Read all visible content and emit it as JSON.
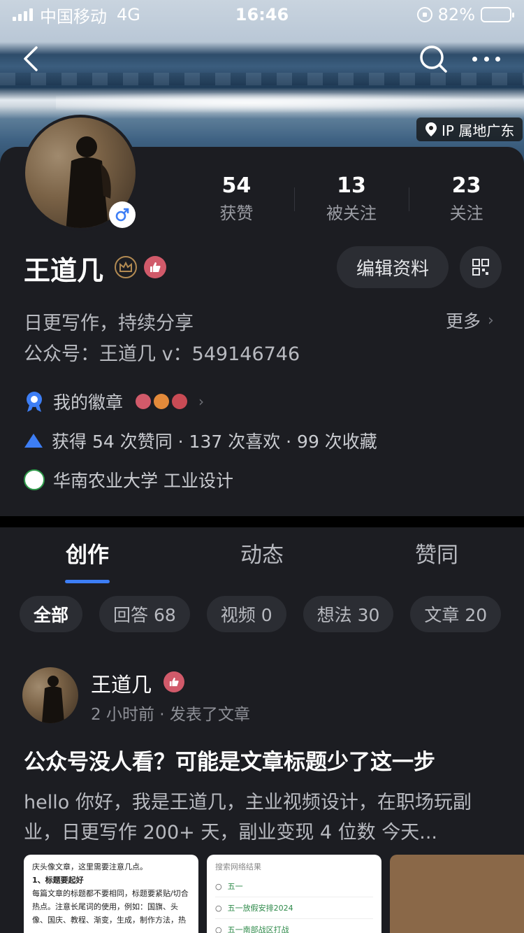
{
  "status_bar": {
    "carrier": "中国移动",
    "network": "4G",
    "time": "16:46",
    "battery": "82%",
    "battery_level": 0.82
  },
  "header": {
    "ip_location": "IP 属地广东",
    "icons": [
      "back-arrow-icon",
      "search-icon",
      "more-icon",
      "location-pin-icon"
    ]
  },
  "profile": {
    "name": "王道几",
    "gender": "male",
    "stats": [
      {
        "num": "54",
        "label": "获赞"
      },
      {
        "num": "13",
        "label": "被关注"
      },
      {
        "num": "23",
        "label": "关注"
      }
    ],
    "edit_button": "编辑资料",
    "bio_line1": "日更写作，持续分享",
    "bio_line2": "公众号：王道几 v：549146746",
    "more_label": "更多",
    "badges_label": "我的徽章",
    "likes_summary": "获得 54 次赞同 · 137 次喜欢 · 99 次收藏",
    "school": "华南农业大学 工业设计"
  },
  "tabs": [
    {
      "label": "创作",
      "active": true
    },
    {
      "label": "动态",
      "active": false
    },
    {
      "label": "赞同",
      "active": false
    }
  ],
  "filters": [
    {
      "label": "全部",
      "active": true
    },
    {
      "label": "回答 68",
      "active": false
    },
    {
      "label": "视频 0",
      "active": false
    },
    {
      "label": "想法 30",
      "active": false
    },
    {
      "label": "文章 20",
      "active": false
    }
  ],
  "post": {
    "author": "王道几",
    "meta": "2 小时前 · 发表了文章",
    "title": "公众号没人看？可能是文章标题少了这一步",
    "excerpt": "hello 你好，我是王道几，主业视频设计，在职场玩副业，日更写作 200+ 天，副业变现 4 位数 今天...",
    "thumb1": {
      "line1": "庆头像文章，这里需要注意几点。",
      "line2": "1、标题要起好",
      "line3": "每篇文章的标题都不要相同，标题要紧贴/切合",
      "line4": "热点。注意长尾词的使用，例如：国旗、头",
      "line5": "像、国庆、教程、渐变，生成，制作方法，热"
    },
    "thumb2": {
      "header": "搜索网络结果",
      "rows": [
        "五一",
        "五一放假安排2024",
        "五一南部战区打战"
      ]
    }
  },
  "colors": {
    "background": "#1c1d22",
    "accent_blue": "#3d7ef5",
    "badge_red": "#d15a6a"
  }
}
